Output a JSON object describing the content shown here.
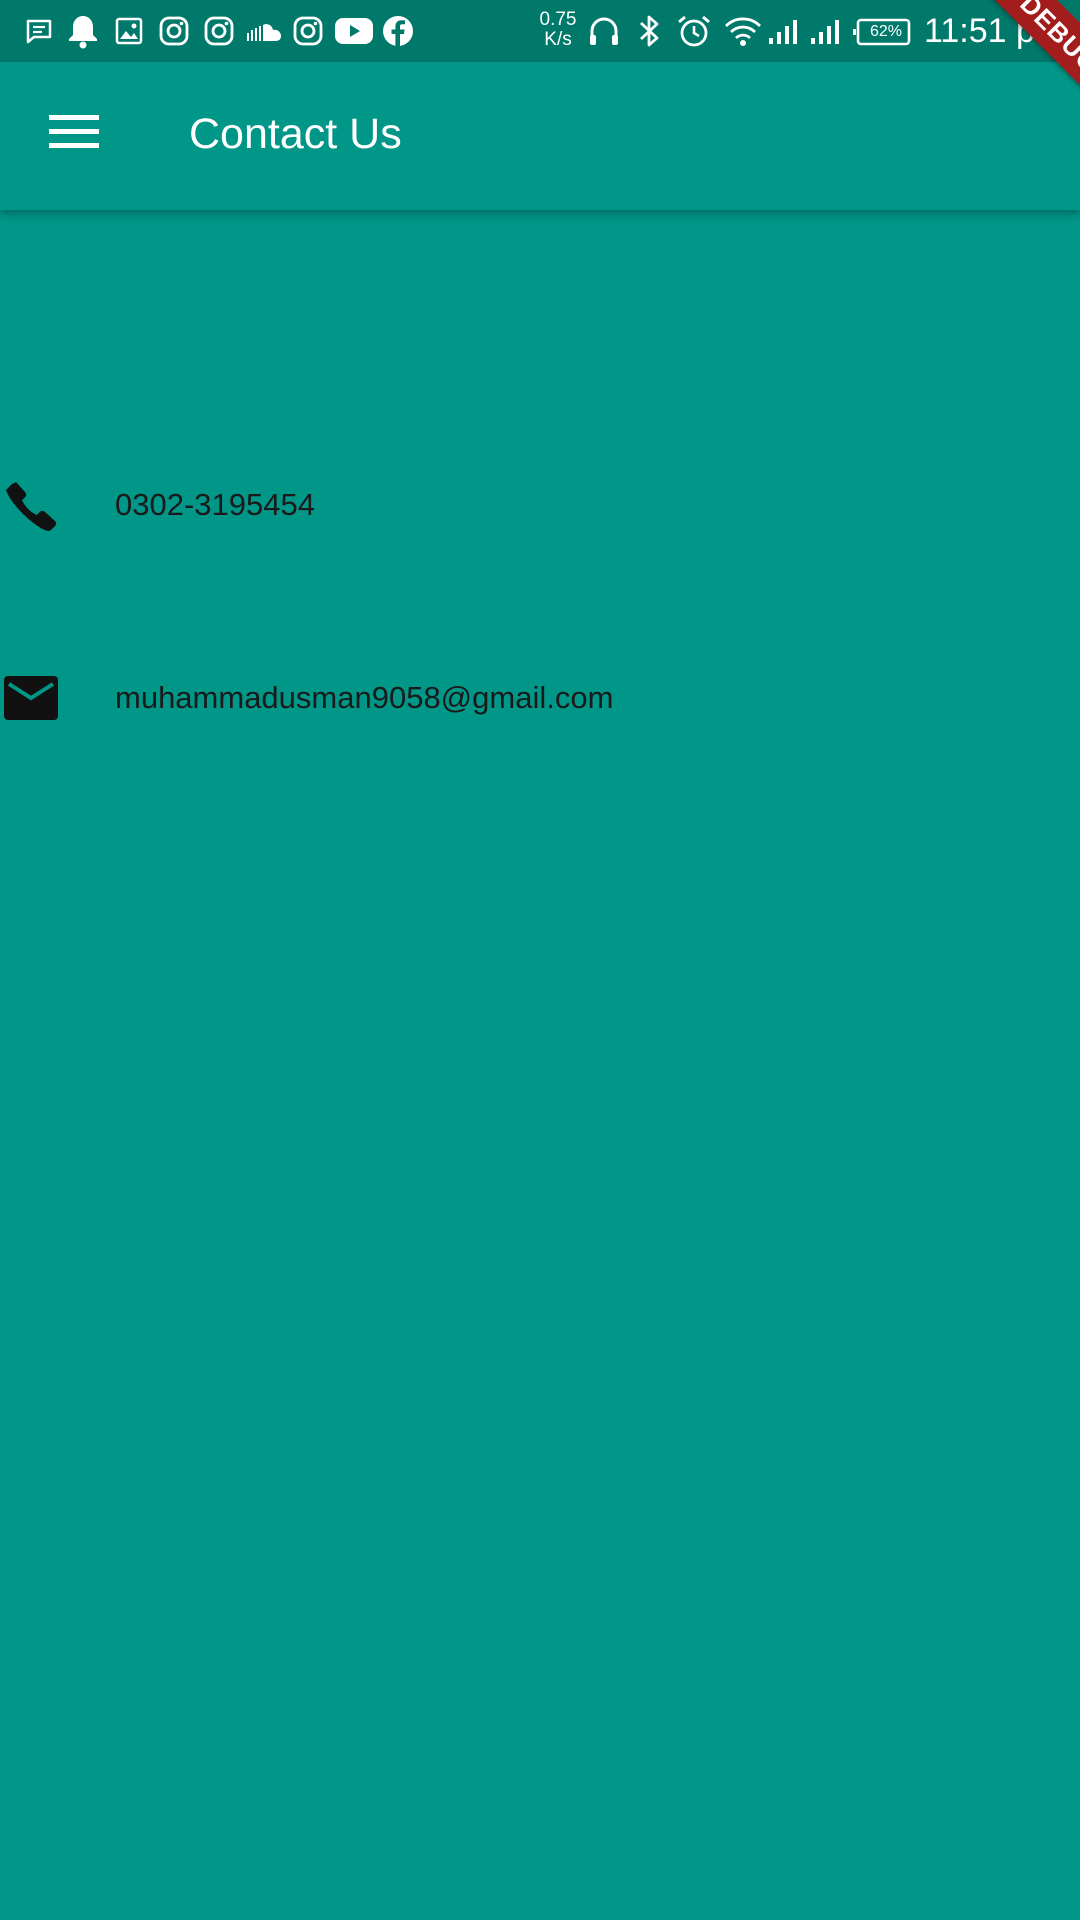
{
  "status_bar": {
    "notification_icons": [
      "message-icon",
      "bell-icon",
      "image-icon",
      "instagram-icon",
      "instagram-icon",
      "soundcloud-icon",
      "instagram-icon",
      "youtube-icon",
      "facebook-icon"
    ],
    "net_speed_value": "0.75",
    "net_speed_unit": "K/s",
    "system_icons": [
      "headphones-icon",
      "bluetooth-icon",
      "alarm-icon",
      "wifi-icon",
      "signal-icon",
      "signal-icon"
    ],
    "battery": "62%",
    "time": "11:51 pm",
    "background_color": "#00796b"
  },
  "app_bar": {
    "menu_icon": "menu-icon",
    "title": "Contact Us",
    "background_color": "#009688"
  },
  "contacts": [
    {
      "icon": "phone-icon",
      "value": "0302-3195454"
    },
    {
      "icon": "email-icon",
      "value": "muhammadusman9058@gmail.com"
    }
  ],
  "debug_banner": {
    "label": "DEBUG",
    "color": "#a31d1d"
  },
  "page": {
    "background_color": "#009688"
  }
}
